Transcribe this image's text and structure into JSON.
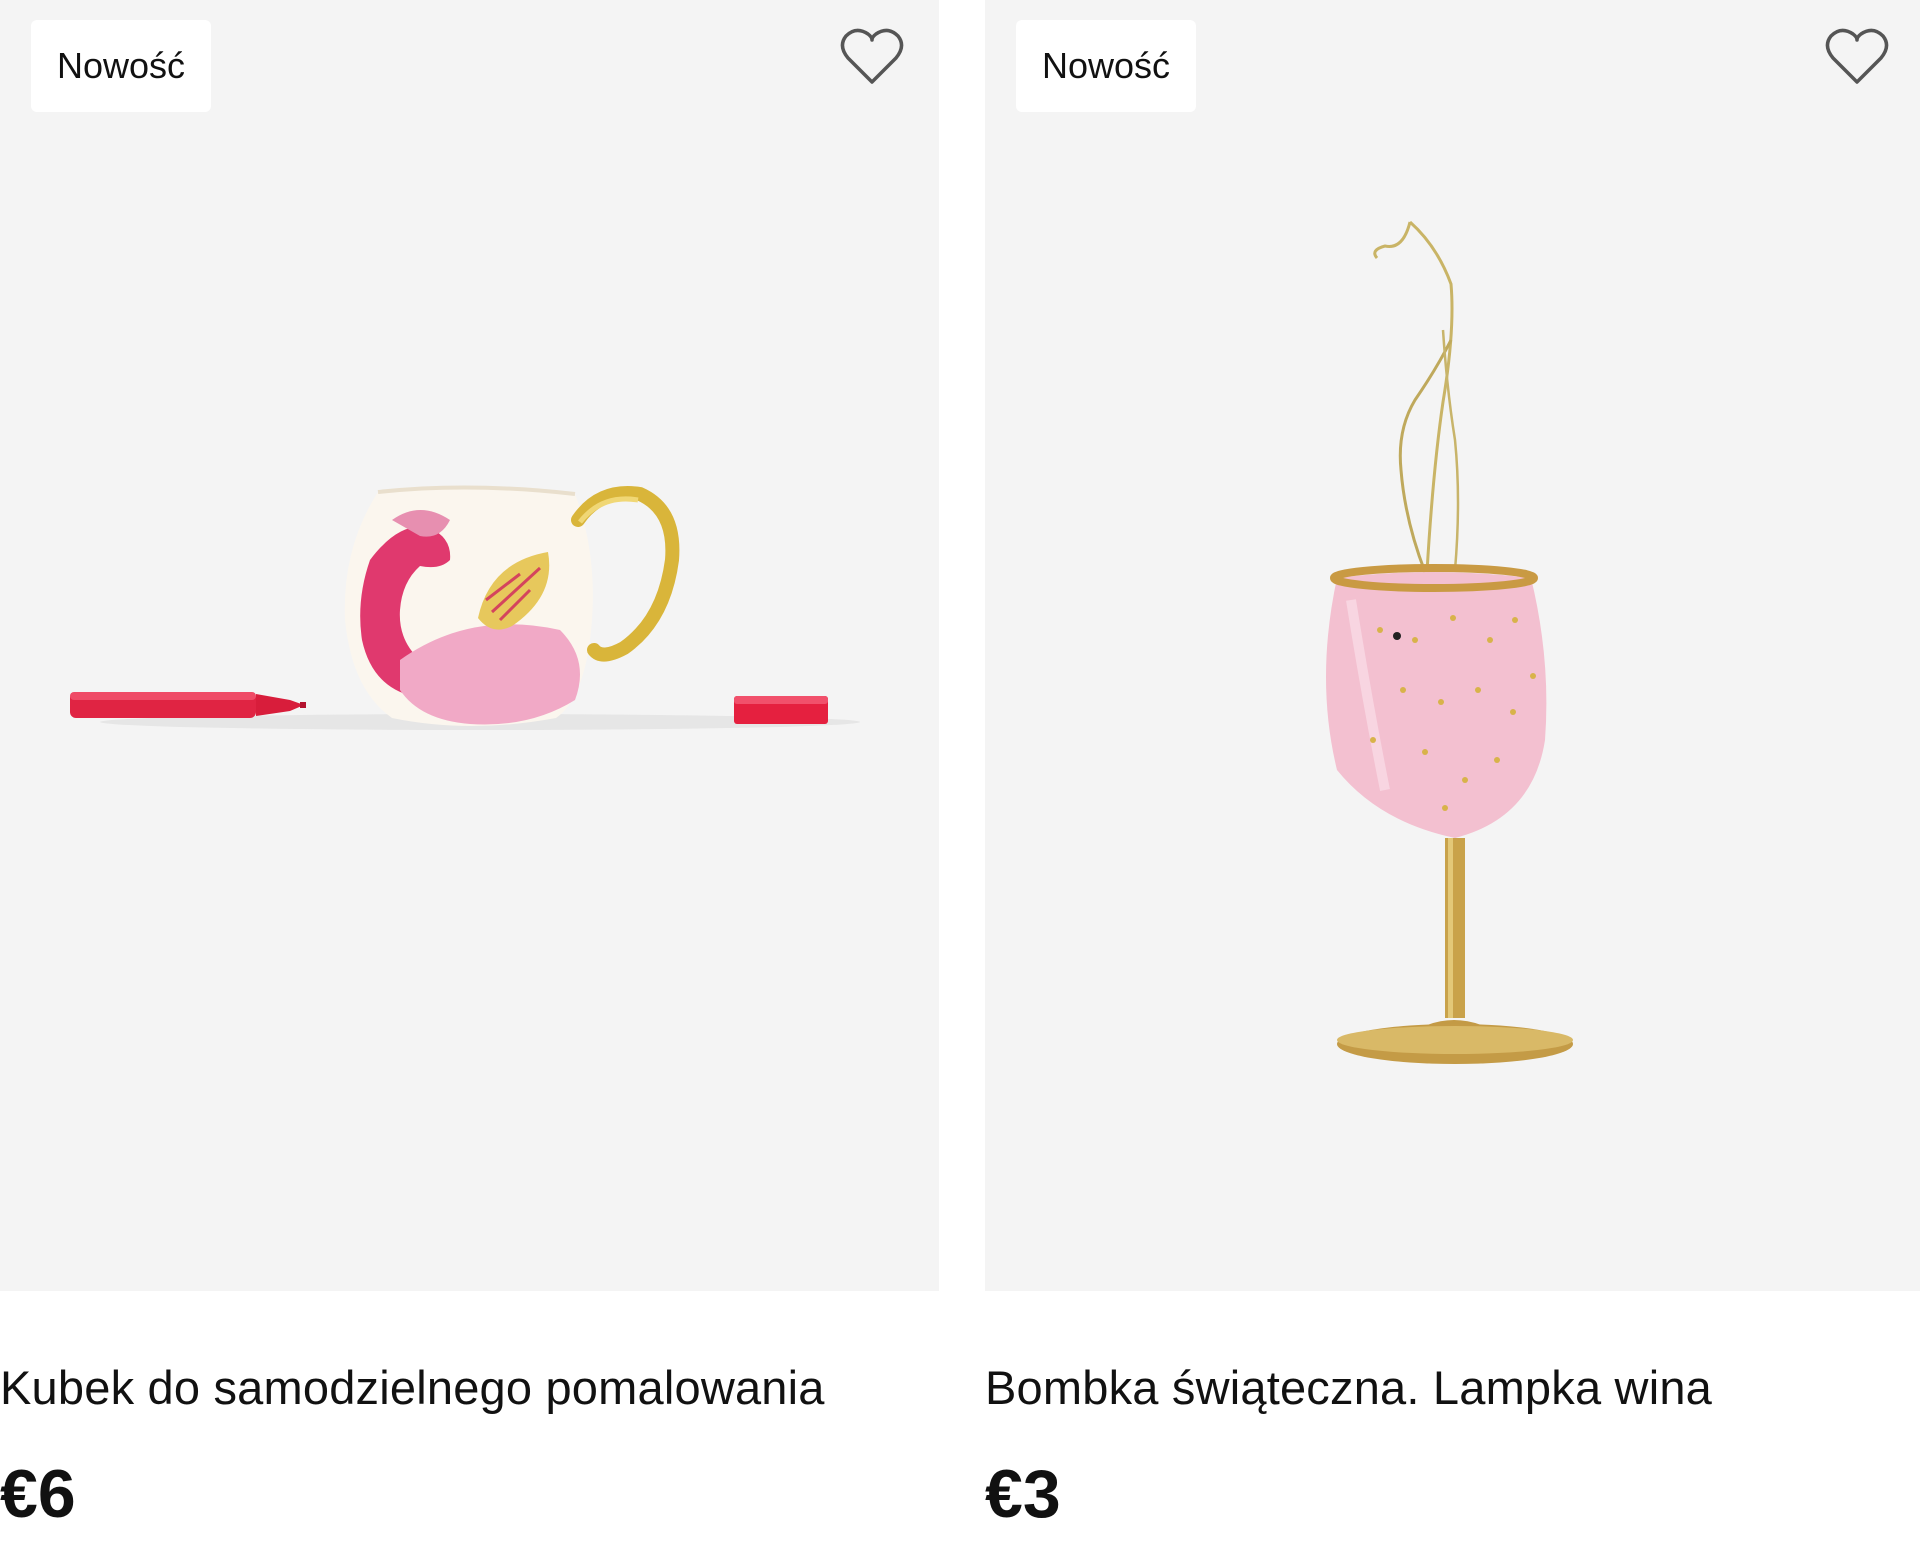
{
  "products": [
    {
      "badge": "Nowość",
      "title": "Kubek do samodzielnego pomalowania",
      "price": "€6",
      "favorite_icon": "heart-outline-icon",
      "image": "painted-mug-with-markers"
    },
    {
      "badge": "Nowość",
      "title": "Bombka świąteczna. Lampka wina",
      "price": "€3",
      "favorite_icon": "heart-outline-icon",
      "image": "pink-wine-glass-ornament"
    }
  ],
  "colors": {
    "image_background": "#f4f4f4",
    "badge_background": "#ffffff",
    "text": "#111111"
  }
}
